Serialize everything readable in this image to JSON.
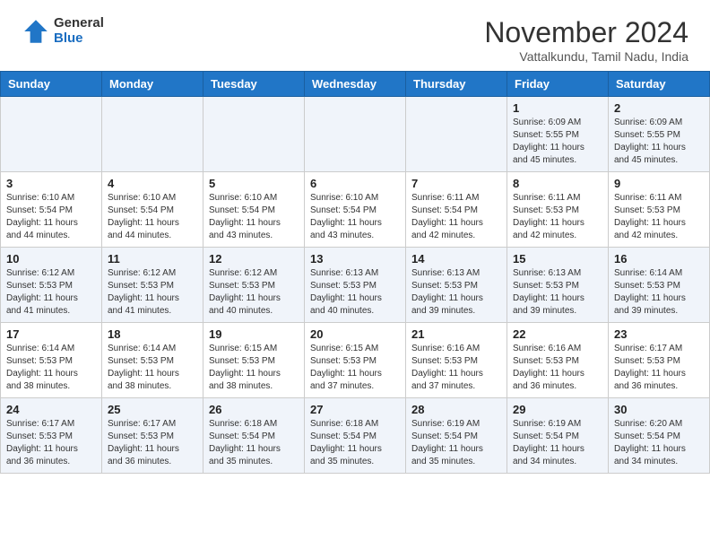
{
  "header": {
    "logo_general": "General",
    "logo_blue": "Blue",
    "month_title": "November 2024",
    "location": "Vattalkundu, Tamil Nadu, India"
  },
  "days_of_week": [
    "Sunday",
    "Monday",
    "Tuesday",
    "Wednesday",
    "Thursday",
    "Friday",
    "Saturday"
  ],
  "weeks": [
    [
      {
        "day": "",
        "info": ""
      },
      {
        "day": "",
        "info": ""
      },
      {
        "day": "",
        "info": ""
      },
      {
        "day": "",
        "info": ""
      },
      {
        "day": "",
        "info": ""
      },
      {
        "day": "1",
        "info": "Sunrise: 6:09 AM\nSunset: 5:55 PM\nDaylight: 11 hours\nand 45 minutes."
      },
      {
        "day": "2",
        "info": "Sunrise: 6:09 AM\nSunset: 5:55 PM\nDaylight: 11 hours\nand 45 minutes."
      }
    ],
    [
      {
        "day": "3",
        "info": "Sunrise: 6:10 AM\nSunset: 5:54 PM\nDaylight: 11 hours\nand 44 minutes."
      },
      {
        "day": "4",
        "info": "Sunrise: 6:10 AM\nSunset: 5:54 PM\nDaylight: 11 hours\nand 44 minutes."
      },
      {
        "day": "5",
        "info": "Sunrise: 6:10 AM\nSunset: 5:54 PM\nDaylight: 11 hours\nand 43 minutes."
      },
      {
        "day": "6",
        "info": "Sunrise: 6:10 AM\nSunset: 5:54 PM\nDaylight: 11 hours\nand 43 minutes."
      },
      {
        "day": "7",
        "info": "Sunrise: 6:11 AM\nSunset: 5:54 PM\nDaylight: 11 hours\nand 42 minutes."
      },
      {
        "day": "8",
        "info": "Sunrise: 6:11 AM\nSunset: 5:53 PM\nDaylight: 11 hours\nand 42 minutes."
      },
      {
        "day": "9",
        "info": "Sunrise: 6:11 AM\nSunset: 5:53 PM\nDaylight: 11 hours\nand 42 minutes."
      }
    ],
    [
      {
        "day": "10",
        "info": "Sunrise: 6:12 AM\nSunset: 5:53 PM\nDaylight: 11 hours\nand 41 minutes."
      },
      {
        "day": "11",
        "info": "Sunrise: 6:12 AM\nSunset: 5:53 PM\nDaylight: 11 hours\nand 41 minutes."
      },
      {
        "day": "12",
        "info": "Sunrise: 6:12 AM\nSunset: 5:53 PM\nDaylight: 11 hours\nand 40 minutes."
      },
      {
        "day": "13",
        "info": "Sunrise: 6:13 AM\nSunset: 5:53 PM\nDaylight: 11 hours\nand 40 minutes."
      },
      {
        "day": "14",
        "info": "Sunrise: 6:13 AM\nSunset: 5:53 PM\nDaylight: 11 hours\nand 39 minutes."
      },
      {
        "day": "15",
        "info": "Sunrise: 6:13 AM\nSunset: 5:53 PM\nDaylight: 11 hours\nand 39 minutes."
      },
      {
        "day": "16",
        "info": "Sunrise: 6:14 AM\nSunset: 5:53 PM\nDaylight: 11 hours\nand 39 minutes."
      }
    ],
    [
      {
        "day": "17",
        "info": "Sunrise: 6:14 AM\nSunset: 5:53 PM\nDaylight: 11 hours\nand 38 minutes."
      },
      {
        "day": "18",
        "info": "Sunrise: 6:14 AM\nSunset: 5:53 PM\nDaylight: 11 hours\nand 38 minutes."
      },
      {
        "day": "19",
        "info": "Sunrise: 6:15 AM\nSunset: 5:53 PM\nDaylight: 11 hours\nand 38 minutes."
      },
      {
        "day": "20",
        "info": "Sunrise: 6:15 AM\nSunset: 5:53 PM\nDaylight: 11 hours\nand 37 minutes."
      },
      {
        "day": "21",
        "info": "Sunrise: 6:16 AM\nSunset: 5:53 PM\nDaylight: 11 hours\nand 37 minutes."
      },
      {
        "day": "22",
        "info": "Sunrise: 6:16 AM\nSunset: 5:53 PM\nDaylight: 11 hours\nand 36 minutes."
      },
      {
        "day": "23",
        "info": "Sunrise: 6:17 AM\nSunset: 5:53 PM\nDaylight: 11 hours\nand 36 minutes."
      }
    ],
    [
      {
        "day": "24",
        "info": "Sunrise: 6:17 AM\nSunset: 5:53 PM\nDaylight: 11 hours\nand 36 minutes."
      },
      {
        "day": "25",
        "info": "Sunrise: 6:17 AM\nSunset: 5:53 PM\nDaylight: 11 hours\nand 36 minutes."
      },
      {
        "day": "26",
        "info": "Sunrise: 6:18 AM\nSunset: 5:54 PM\nDaylight: 11 hours\nand 35 minutes."
      },
      {
        "day": "27",
        "info": "Sunrise: 6:18 AM\nSunset: 5:54 PM\nDaylight: 11 hours\nand 35 minutes."
      },
      {
        "day": "28",
        "info": "Sunrise: 6:19 AM\nSunset: 5:54 PM\nDaylight: 11 hours\nand 35 minutes."
      },
      {
        "day": "29",
        "info": "Sunrise: 6:19 AM\nSunset: 5:54 PM\nDaylight: 11 hours\nand 34 minutes."
      },
      {
        "day": "30",
        "info": "Sunrise: 6:20 AM\nSunset: 5:54 PM\nDaylight: 11 hours\nand 34 minutes."
      }
    ]
  ]
}
